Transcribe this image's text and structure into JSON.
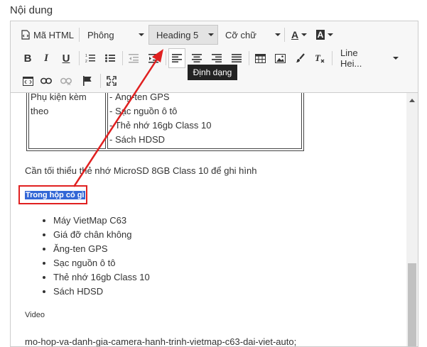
{
  "field_label": "Nội dung",
  "toolbar": {
    "html_label": "Mã HTML",
    "font_label": "Phông",
    "heading_label": "Heading 5",
    "size_label": "Cỡ chữ",
    "font_color_label": "A",
    "bg_color_label": "A",
    "line_height_label": "Line Hei...",
    "tooltip": "Định dạng"
  },
  "content": {
    "table": {
      "left": [
        "Phụ kiện kèm theo"
      ],
      "right": [
        "- Ăng-ten GPS",
        "- Sạc nguồn ô tô",
        "- Thẻ nhớ 16gb Class 10",
        "- Sách HDSD"
      ]
    },
    "note": "Cần tối thiểu thẻ nhớ MicroSD 8GB Class 10 để ghi hình",
    "selected_heading": "Trong hộp có gì",
    "list": [
      "Máy VietMap C63",
      "Giá đỡ chân không",
      "Ăng-ten GPS",
      "Sạc nguồn ô tô",
      "Thẻ nhớ 16gb Class 10",
      "Sách HDSD"
    ],
    "video_label": "Video",
    "slug": "mo-hop-va-danh-gia-camera-hanh-trinh-vietmap-c63-dai-viet-auto;"
  },
  "colors": {
    "highlight": "#3367d6",
    "annotation": "#e02020",
    "tooltip_bg": "#222222"
  }
}
